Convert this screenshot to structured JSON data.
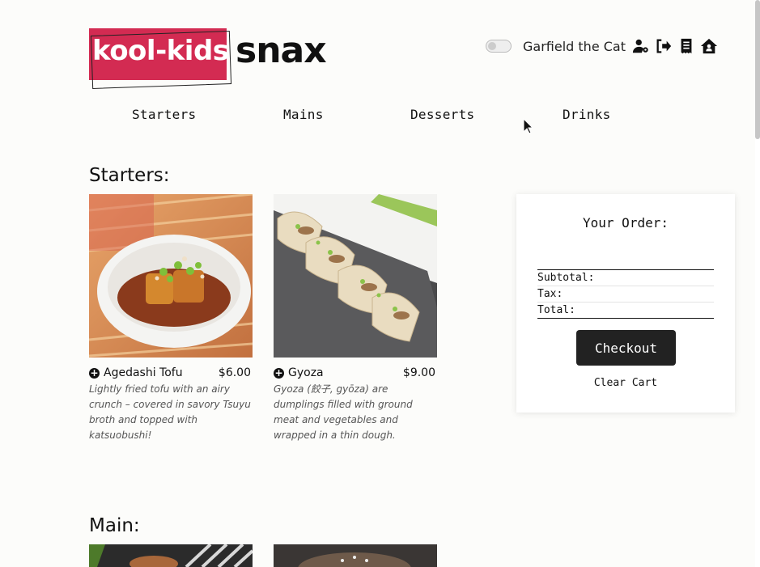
{
  "brand": {
    "logo_primary": "kool-kids",
    "logo_secondary": "snax",
    "accent_color": "#d32b52"
  },
  "userbar": {
    "toggle_state": "off",
    "username": "Garfield the Cat",
    "icons": [
      "user-settings-icon",
      "sign-out-icon",
      "receipt-icon",
      "home-icon"
    ]
  },
  "nav": {
    "items": [
      "Starters",
      "Mains",
      "Desserts",
      "Drinks"
    ]
  },
  "sections": {
    "starters": {
      "title": "Starters:",
      "items": [
        {
          "name": "Agedashi Tofu",
          "price": "$6.00",
          "description": "Lightly fried tofu with an airy crunch – covered in savory Tsuyu broth and topped with katsuobushi!"
        },
        {
          "name": "Gyoza",
          "price": "$9.00",
          "description": "Gyoza (餃子, gyōza) are dumplings filled with ground meat and vegetables and wrapped in a thin dough."
        }
      ]
    },
    "main": {
      "title": "Main:"
    }
  },
  "order": {
    "title": "Your Order:",
    "subtotal_label": "Subtotal:",
    "tax_label": "Tax:",
    "total_label": "Total:",
    "checkout_label": "Checkout",
    "clear_label": "Clear Cart"
  }
}
